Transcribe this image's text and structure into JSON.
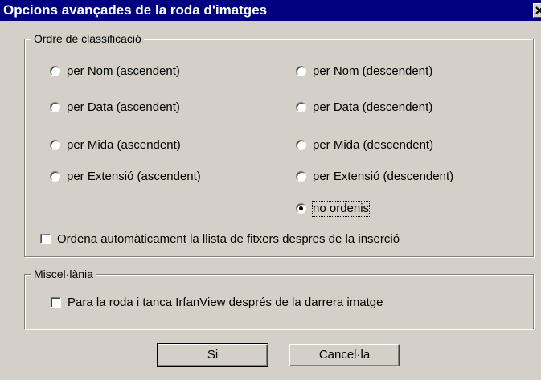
{
  "window": {
    "title": "Opcions avançades de la roda d'imatges",
    "close_icon": "close-icon"
  },
  "sort_group": {
    "title": "Ordre de classificació",
    "options": [
      {
        "label": "per Nom (ascendent)",
        "selected": false
      },
      {
        "label": "per Nom (descendent)",
        "selected": false
      },
      {
        "label": "per Data (ascendent)",
        "selected": false
      },
      {
        "label": "per Data (descendent)",
        "selected": false
      },
      {
        "label": "per Mida (ascendent)",
        "selected": false
      },
      {
        "label": "per Mida (descendent)",
        "selected": false
      },
      {
        "label": "per Extensió (ascendent)",
        "selected": false
      },
      {
        "label": "per Extensió (descendent)",
        "selected": false
      },
      {
        "label": "no ordenis",
        "selected": true
      }
    ],
    "auto_sort": {
      "label": "Ordena automàticament la llista de fitxers despres de la inserció",
      "checked": false
    }
  },
  "misc_group": {
    "title": "Miscel·lània",
    "stop_close": {
      "label": "Para la roda i tanca IrfanView després de la darrera imatge",
      "checked": false
    }
  },
  "buttons": {
    "ok": "Si",
    "cancel": "Cancel·la"
  }
}
